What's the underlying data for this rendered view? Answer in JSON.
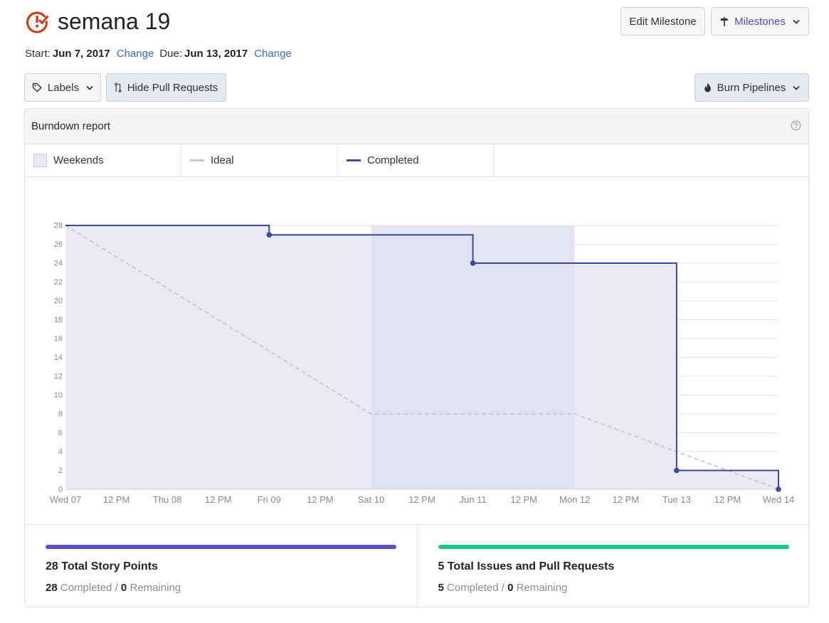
{
  "milestone": {
    "title": "semana 19"
  },
  "dates": {
    "start_label": "Start:",
    "start_date": "Jun 7, 2017",
    "due_label": "Due:",
    "due_date": "Jun 13, 2017",
    "change_label": "Change"
  },
  "buttons": {
    "edit_milestone": "Edit Milestone",
    "milestones": "Milestones",
    "labels": "Labels",
    "hide_pull_requests": "Hide Pull Requests",
    "burn_pipelines": "Burn Pipelines"
  },
  "report": {
    "title": "Burndown report",
    "legend": {
      "weekends": "Weekends",
      "ideal": "Ideal",
      "completed": "Completed"
    }
  },
  "chart_data": {
    "type": "line",
    "x_unit": "days since Wed 07 00:00",
    "xlim": [
      0,
      7
    ],
    "ylim": [
      0,
      28
    ],
    "y_ticks": [
      0,
      2,
      4,
      6,
      8,
      10,
      12,
      14,
      16,
      18,
      20,
      22,
      24,
      26,
      28
    ],
    "x_tick_labels": [
      "Wed 07",
      "12 PM",
      "Thu 08",
      "12 PM",
      "Fri 09",
      "12 PM",
      "Sat 10",
      "12 PM",
      "Jun 11",
      "12 PM",
      "Mon 12",
      "12 PM",
      "Tue 13",
      "12 PM",
      "Wed 14"
    ],
    "weekend_range": [
      3,
      5
    ],
    "grid": true,
    "series": [
      {
        "name": "Ideal",
        "style": "dashed",
        "color": "#c8c8cc",
        "points": [
          [
            0,
            28
          ],
          [
            3,
            8
          ],
          [
            5,
            8
          ],
          [
            7,
            0
          ]
        ]
      },
      {
        "name": "Completed",
        "style": "step",
        "color": "#3b4a9a",
        "points": [
          [
            0,
            28
          ],
          [
            2,
            28
          ],
          [
            2,
            27
          ],
          [
            4,
            27
          ],
          [
            4,
            24
          ],
          [
            6,
            24
          ],
          [
            6,
            2
          ],
          [
            7,
            2
          ],
          [
            7,
            0
          ]
        ],
        "markers": [
          [
            2,
            27
          ],
          [
            4,
            24
          ],
          [
            6,
            2
          ],
          [
            7,
            0
          ]
        ]
      }
    ]
  },
  "summary": {
    "story_points": {
      "title": "28 Total Story Points",
      "completed": "28",
      "completed_label": "Completed",
      "separator": "/",
      "remaining": "0",
      "remaining_label": "Remaining",
      "bar_color": "#5b53b9"
    },
    "issues": {
      "title": "5 Total Issues and Pull Requests",
      "completed": "5",
      "completed_label": "Completed",
      "separator": "/",
      "remaining": "0",
      "remaining_label": "Remaining",
      "bar_color": "#18c98a"
    }
  },
  "colors": {
    "milestone_icon": "#c8401f",
    "link": "#3a6bb8",
    "completed_line": "#3b4a9a",
    "ideal_line": "#c8c8cc",
    "fill": "#eaeaf6",
    "weekend": "#dee1f3"
  }
}
